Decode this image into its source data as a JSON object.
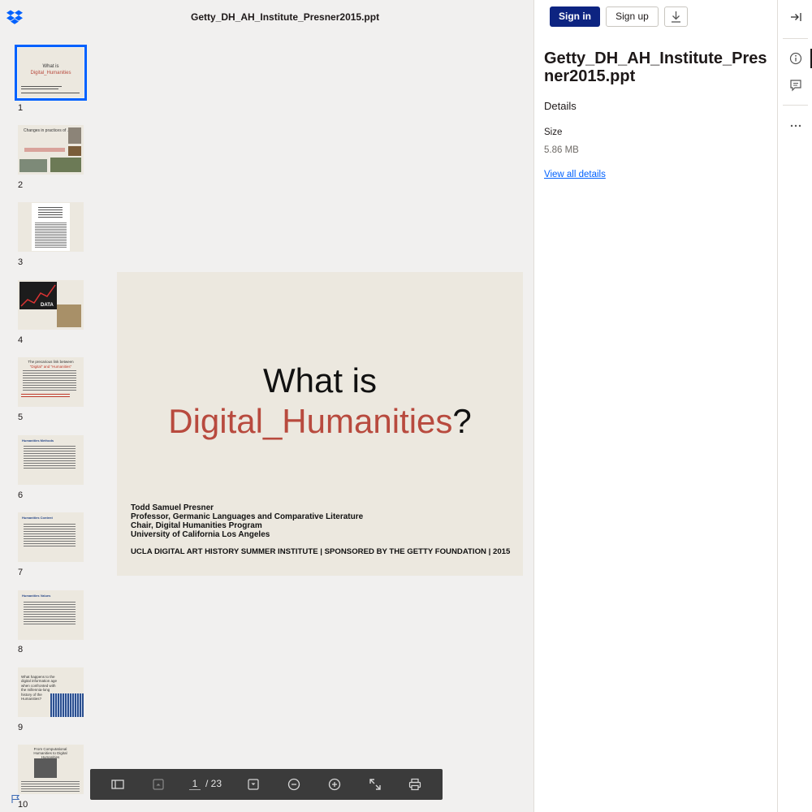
{
  "document": {
    "title": "Getty_DH_AH_Institute_Presner2015.ppt"
  },
  "thumbnails": [
    {
      "number": "1",
      "title_a": "What is",
      "title_b": "Digital_Humanities"
    },
    {
      "number": "2",
      "title_a": "Changes in practices of ..."
    },
    {
      "number": "3"
    },
    {
      "number": "4",
      "title_a": "DATA"
    },
    {
      "number": "5",
      "title_a": "The precarious link between",
      "title_b": "\"Digital\" and \"Humanities\""
    },
    {
      "number": "6",
      "title_a": "Humanities Methods"
    },
    {
      "number": "7",
      "title_a": "Humanities Content"
    },
    {
      "number": "8",
      "title_a": "Humanities Values"
    },
    {
      "number": "9",
      "title_a": "What happens to the digital information age when confronted with the millennia-long history of the Humanities?"
    },
    {
      "number": "10",
      "title_a": "From Computational Humanities to Digital Humanities"
    }
  ],
  "slide": {
    "line1": "What is",
    "line2": "Digital_Humanities",
    "line2_suffix": "?",
    "authors": [
      "Todd Samuel Presner",
      "Professor, Germanic Languages and Comparative Literature",
      "Chair, Digital Humanities Program",
      "University of California Los Angeles"
    ],
    "footer": "UCLA DIGITAL ART HISTORY SUMMER INSTITUTE | SPONSORED BY THE GETTY FOUNDATION | 2015"
  },
  "toolbar": {
    "current_page": "1",
    "total_pages": "/ 23"
  },
  "panel": {
    "sign_in": "Sign in",
    "sign_up": "Sign up",
    "file_title": "Getty_DH_AH_Institute_Presner2015.ppt",
    "details_heading": "Details",
    "size_label": "Size",
    "size_value": "5.86 MB",
    "view_all": "View all details"
  },
  "icons": {
    "logo": "dropbox-logo-icon",
    "sidebar_toggle": "sidebar-toggle-icon",
    "prev": "prev-page-icon",
    "next": "next-page-icon",
    "zoom_out": "zoom-out-icon",
    "zoom_in": "zoom-in-icon",
    "fullscreen": "fullscreen-icon",
    "print": "print-icon",
    "download": "download-icon",
    "collapse": "collapse-panel-icon",
    "info": "info-icon",
    "comment": "comment-icon",
    "more": "more-icon",
    "flag": "flag-icon"
  },
  "colors": {
    "accent": "#0061fe",
    "sign_in_bg": "#0d2481",
    "slide_red": "#b84a3e"
  }
}
